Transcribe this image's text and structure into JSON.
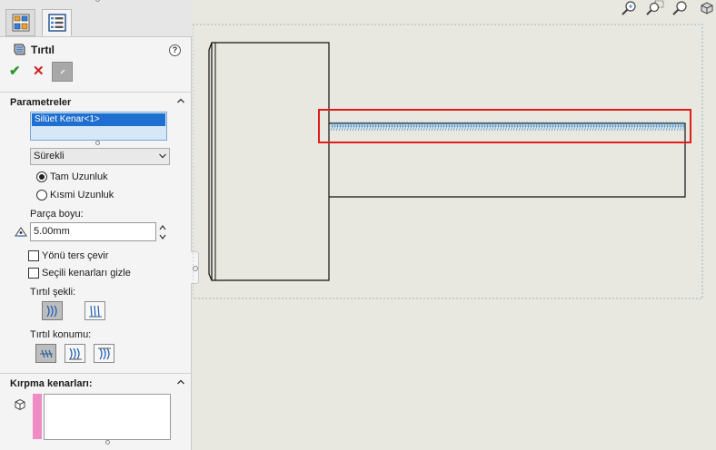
{
  "feature": {
    "title": "Tırtıl",
    "help_glyph": "?"
  },
  "actions": {
    "ok_glyph": "✔",
    "cancel_glyph": "✕"
  },
  "parameters": {
    "header": "Parametreler",
    "selection_items": [
      "Silüet Kenar<1>"
    ],
    "type_selected": "Sürekli",
    "length_options": [
      {
        "label": "Tam Uzunluk",
        "checked": true
      },
      {
        "label": "Kısmi Uzunluk",
        "checked": false
      }
    ],
    "part_length_label": "Parça boyu:",
    "part_length_value": "5.00mm",
    "reverse_label": "Yönü ters çevir",
    "reverse_checked": false,
    "hide_edges_label": "Seçili kenarları gizle",
    "hide_edges_checked": false,
    "shape_label": "Tırtıl şekli:",
    "shape_options": [
      "shape-angled",
      "shape-vertical"
    ],
    "shape_selected": 0,
    "position_label": "Tırtıl konumu:",
    "position_options": [
      "position-center",
      "position-left",
      "position-right"
    ],
    "position_selected": 0
  },
  "trim": {
    "header": "Kırpma kenarları:",
    "items": []
  },
  "colors": {
    "accent_blue": "#1f6fd0",
    "highlight_red": "#e21b1b",
    "knurl_blue": "#3a8fd8",
    "trim_pink": "#f08cc4",
    "viewport_bg": "#e9e8e0"
  },
  "view_tools": [
    "zoom-to-fit-icon",
    "zoom-to-area-icon",
    "zoom-previous-icon",
    "view-orientation-icon"
  ]
}
